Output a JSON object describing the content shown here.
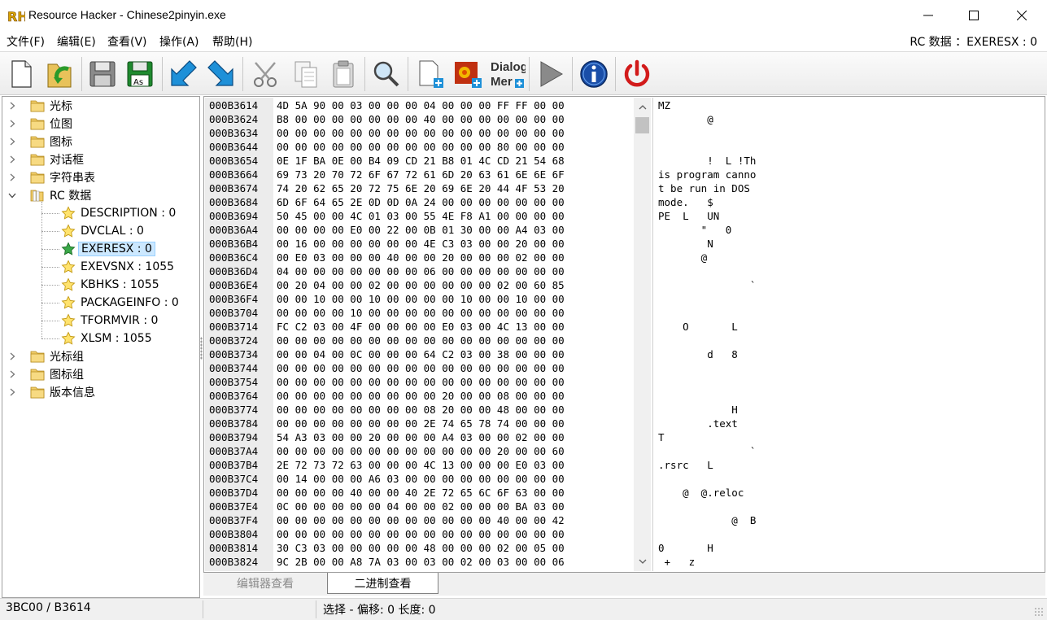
{
  "window": {
    "title": "Resource Hacker - Chinese2pinyin.exe",
    "logo_text": "RH"
  },
  "menu": {
    "items": [
      "文件(F)",
      "编辑(E)",
      "查看(V)",
      "操作(A)",
      "帮助(H)"
    ],
    "rc_status": "RC 数据 ：EXERESX : 0"
  },
  "toolbar": {
    "dialog_menu_label_1": "Dialog",
    "dialog_menu_label_2": "Mer"
  },
  "tree": {
    "folders_top": [
      "光标",
      "位图",
      "图标",
      "对话框",
      "字符串表"
    ],
    "rc_folder": "RC 数据",
    "rc_children": [
      "DESCRIPTION : 0",
      "DVCLAL : 0",
      "EXERESX : 0",
      "EXEVSNX : 1055",
      "KBHKS : 1055",
      "PACKAGEINFO : 0",
      "TFORMVIR : 0",
      "XLSM : 1055"
    ],
    "selected": "EXERESX : 0",
    "folders_bottom": [
      "光标组",
      "图标组",
      "版本信息"
    ]
  },
  "hex": {
    "rows": [
      {
        "addr": "000B3614",
        "bytes": "4D 5A 90 00 03 00 00 00 04 00 00 00 FF FF 00 00",
        "ascii": "MZ"
      },
      {
        "addr": "000B3624",
        "bytes": "B8 00 00 00 00 00 00 00 40 00 00 00 00 00 00 00",
        "ascii": "        @"
      },
      {
        "addr": "000B3634",
        "bytes": "00 00 00 00 00 00 00 00 00 00 00 00 00 00 00 00",
        "ascii": ""
      },
      {
        "addr": "000B3644",
        "bytes": "00 00 00 00 00 00 00 00 00 00 00 00 80 00 00 00",
        "ascii": ""
      },
      {
        "addr": "000B3654",
        "bytes": "0E 1F BA 0E 00 B4 09 CD 21 B8 01 4C CD 21 54 68",
        "ascii": "        !  L !Th"
      },
      {
        "addr": "000B3664",
        "bytes": "69 73 20 70 72 6F 67 72 61 6D 20 63 61 6E 6E 6F",
        "ascii": "is program canno"
      },
      {
        "addr": "000B3674",
        "bytes": "74 20 62 65 20 72 75 6E 20 69 6E 20 44 4F 53 20",
        "ascii": "t be run in DOS"
      },
      {
        "addr": "000B3684",
        "bytes": "6D 6F 64 65 2E 0D 0D 0A 24 00 00 00 00 00 00 00",
        "ascii": "mode.   $"
      },
      {
        "addr": "000B3694",
        "bytes": "50 45 00 00 4C 01 03 00 55 4E F8 A1 00 00 00 00",
        "ascii": "PE  L   UN"
      },
      {
        "addr": "000B36A4",
        "bytes": "00 00 00 00 E0 00 22 00 0B 01 30 00 00 A4 03 00",
        "ascii": "       \"   0"
      },
      {
        "addr": "000B36B4",
        "bytes": "00 16 00 00 00 00 00 00 4E C3 03 00 00 20 00 00",
        "ascii": "        N"
      },
      {
        "addr": "000B36C4",
        "bytes": "00 E0 03 00 00 00 40 00 00 20 00 00 00 02 00 00",
        "ascii": "       @"
      },
      {
        "addr": "000B36D4",
        "bytes": "04 00 00 00 00 00 00 00 06 00 00 00 00 00 00 00",
        "ascii": ""
      },
      {
        "addr": "000B36E4",
        "bytes": "00 20 04 00 00 02 00 00 00 00 00 00 02 00 60 85",
        "ascii": "               `"
      },
      {
        "addr": "000B36F4",
        "bytes": "00 00 10 00 00 10 00 00 00 00 10 00 00 10 00 00",
        "ascii": ""
      },
      {
        "addr": "000B3704",
        "bytes": "00 00 00 00 10 00 00 00 00 00 00 00 00 00 00 00",
        "ascii": ""
      },
      {
        "addr": "000B3714",
        "bytes": "FC C2 03 00 4F 00 00 00 00 E0 03 00 4C 13 00 00",
        "ascii": "    O       L"
      },
      {
        "addr": "000B3724",
        "bytes": "00 00 00 00 00 00 00 00 00 00 00 00 00 00 00 00",
        "ascii": ""
      },
      {
        "addr": "000B3734",
        "bytes": "00 00 04 00 0C 00 00 00 64 C2 03 00 38 00 00 00",
        "ascii": "        d   8"
      },
      {
        "addr": "000B3744",
        "bytes": "00 00 00 00 00 00 00 00 00 00 00 00 00 00 00 00",
        "ascii": ""
      },
      {
        "addr": "000B3754",
        "bytes": "00 00 00 00 00 00 00 00 00 00 00 00 00 00 00 00",
        "ascii": ""
      },
      {
        "addr": "000B3764",
        "bytes": "00 00 00 00 00 00 00 00 00 20 00 00 08 00 00 00",
        "ascii": ""
      },
      {
        "addr": "000B3774",
        "bytes": "00 00 00 00 00 00 00 00 08 20 00 00 48 00 00 00",
        "ascii": "            H"
      },
      {
        "addr": "000B3784",
        "bytes": "00 00 00 00 00 00 00 00 2E 74 65 78 74 00 00 00",
        "ascii": "        .text"
      },
      {
        "addr": "000B3794",
        "bytes": "54 A3 03 00 00 20 00 00 00 A4 03 00 00 02 00 00",
        "ascii": "T"
      },
      {
        "addr": "000B37A4",
        "bytes": "00 00 00 00 00 00 00 00 00 00 00 00 20 00 00 60",
        "ascii": "               `"
      },
      {
        "addr": "000B37B4",
        "bytes": "2E 72 73 72 63 00 00 00 4C 13 00 00 00 E0 03 00",
        "ascii": ".rsrc   L"
      },
      {
        "addr": "000B37C4",
        "bytes": "00 14 00 00 00 A6 03 00 00 00 00 00 00 00 00 00",
        "ascii": ""
      },
      {
        "addr": "000B37D4",
        "bytes": "00 00 00 00 40 00 00 40 2E 72 65 6C 6F 63 00 00",
        "ascii": "    @  @.reloc"
      },
      {
        "addr": "000B37E4",
        "bytes": "0C 00 00 00 00 00 04 00 00 02 00 00 00 BA 03 00",
        "ascii": ""
      },
      {
        "addr": "000B37F4",
        "bytes": "00 00 00 00 00 00 00 00 00 00 00 00 40 00 00 42",
        "ascii": "            @  B"
      },
      {
        "addr": "000B3804",
        "bytes": "00 00 00 00 00 00 00 00 00 00 00 00 00 00 00 00",
        "ascii": ""
      },
      {
        "addr": "000B3814",
        "bytes": "30 C3 03 00 00 00 00 00 48 00 00 00 02 00 05 00",
        "ascii": "0       H"
      },
      {
        "addr": "000B3824",
        "bytes": "9C 2B 00 00 A8 7A 03 00 03 00 02 00 03 00 00 06",
        "ascii": " +   z"
      }
    ]
  },
  "tabs": {
    "editor_view": "编辑器查看",
    "binary_view": "二进制查看"
  },
  "status": {
    "position": "3BC00 / B3614",
    "selection": "选择 - 偏移: 0 长度: 0"
  },
  "colors": {
    "selection_bg": "#cce8ff",
    "address_bg": "#ececec",
    "toolbar_bg": "#f0f0f0"
  }
}
